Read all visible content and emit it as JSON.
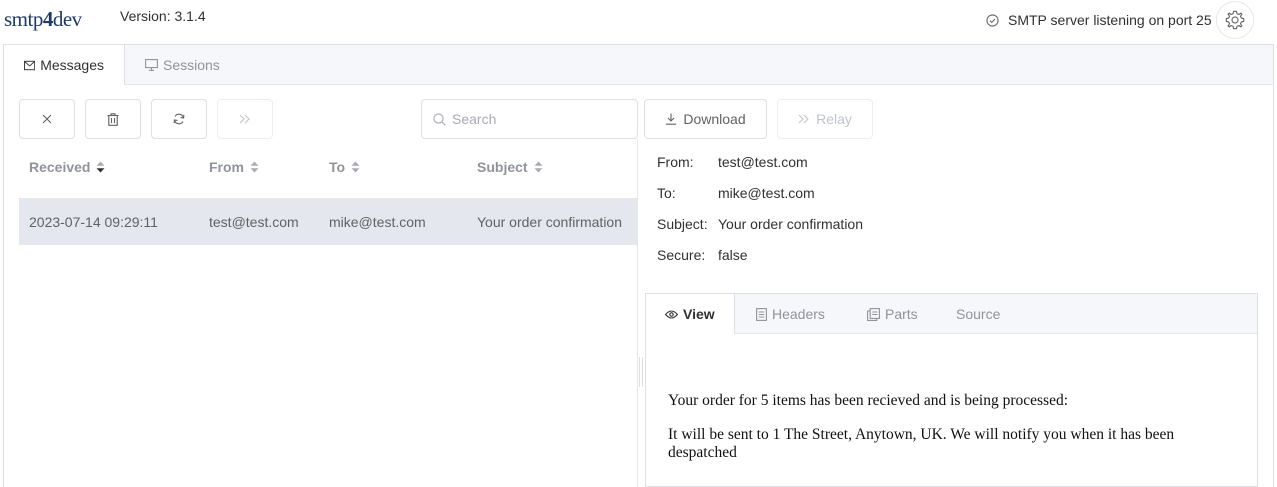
{
  "app": {
    "logo_text_a": "smtp",
    "logo_text_b": "4",
    "logo_text_c": "dev",
    "version": "Version: 3.1.4",
    "status": "SMTP server listening on port 25"
  },
  "tabs": [
    {
      "label": "Messages",
      "active": true
    },
    {
      "label": "Sessions",
      "active": false
    }
  ],
  "toolbar": {
    "search_placeholder": "Search",
    "download_label": "Download",
    "relay_label": "Relay"
  },
  "table": {
    "columns": [
      "Received",
      "From",
      "To",
      "Subject"
    ],
    "rows": [
      {
        "received": "2023-07-14 09:29:11",
        "from": "test@test.com",
        "to": "mike@test.com",
        "subject": "Your order confirmation"
      }
    ]
  },
  "detail": {
    "from_label": "From:",
    "from": "test@test.com",
    "to_label": "To:",
    "to": "mike@test.com",
    "subject_label": "Subject:",
    "subject": "Your order confirmation",
    "secure_label": "Secure:",
    "secure": "false"
  },
  "detail_tabs": [
    {
      "label": "View",
      "active": true
    },
    {
      "label": "Headers",
      "active": false
    },
    {
      "label": "Parts",
      "active": false
    },
    {
      "label": "Source",
      "active": false
    }
  ],
  "message_body": {
    "line1": "Your order for 5 items has been recieved and is being processed:",
    "line2": "It will be sent to 1 The Street, Anytown, UK. We will notify you when it has been",
    "line3": "despatched"
  },
  "colors": {
    "brand": "#1d3a6b",
    "selected_row": "#e4e7ed",
    "tab_bar": "#f5f7fa"
  }
}
